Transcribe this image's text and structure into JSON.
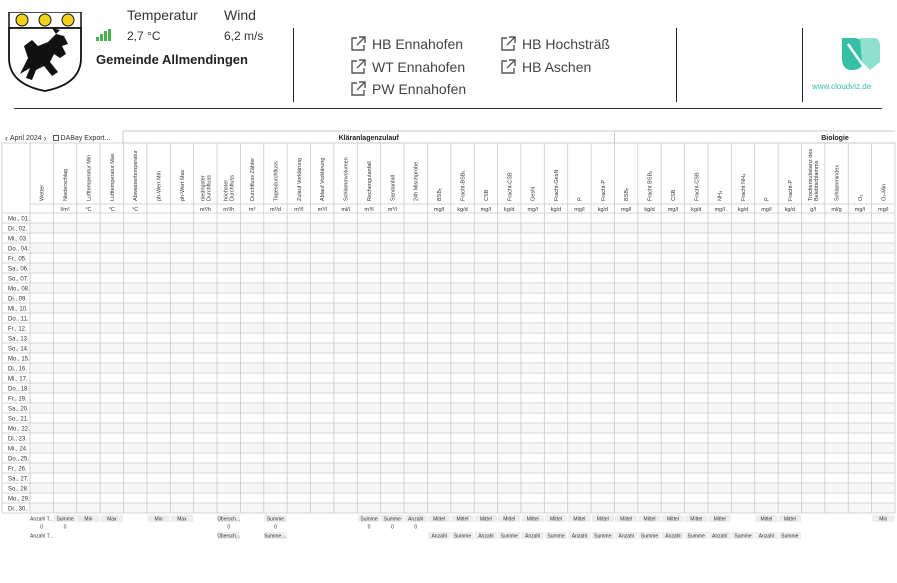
{
  "weather": {
    "temp_label": "Temperatur",
    "temp_value": "2,7 °C",
    "wind_label": "Wind",
    "wind_value": "6,2 m/s"
  },
  "municipality": "Gemeinde Allmendingen",
  "links": [
    {
      "label": "HB Ennahofen"
    },
    {
      "label": "WT Ennahofen"
    },
    {
      "label": "PW Ennahofen"
    },
    {
      "label": "HB Hochsträß"
    },
    {
      "label": "HB Aschen"
    }
  ],
  "brand": {
    "url": "www.cloudviz.de",
    "color": "#35bfa7"
  },
  "toolbar": {
    "month": "April 2024",
    "export_label": "DABay Export..."
  },
  "table": {
    "group_headers": [
      {
        "label": "Kläranlagenzulauf"
      },
      {
        "label": "Biologie"
      }
    ],
    "columns": [
      {
        "label": "Wetter",
        "unit": ""
      },
      {
        "label": "Niederschlag",
        "unit": "l/m²"
      },
      {
        "label": "Lufttemperatur Min",
        "unit": "°C"
      },
      {
        "label": "Lufttemperatur Max",
        "unit": "°C"
      },
      {
        "label": "Abwassertemperatur",
        "unit": "°C"
      },
      {
        "label": "ph-Wert Min",
        "unit": ""
      },
      {
        "label": "ph-Wert Max",
        "unit": ""
      },
      {
        "label": "niedrigster Durchfluss",
        "unit": "m³/h"
      },
      {
        "label": "höchster Durchfluss",
        "unit": "m³/h"
      },
      {
        "label": "Durchfluss Zähler",
        "unit": "m³"
      },
      {
        "label": "Tagesdurchfluss",
        "unit": "m³/d"
      },
      {
        "label": "Zulauf Vorklärung",
        "unit": "m³/l"
      },
      {
        "label": "Ablauf Vorklärung",
        "unit": "m³/l"
      },
      {
        "label": "Schlammvolumen",
        "unit": "ml/l"
      },
      {
        "label": "Rechengutanfall",
        "unit": "m³/l"
      },
      {
        "label": "Sandanfall",
        "unit": "m³/l"
      },
      {
        "label": "24h Mischprobe",
        "unit": ""
      },
      {
        "label": "BSB₅",
        "unit": "mg/l"
      },
      {
        "label": "Fracht-BSB₅",
        "unit": "kg/d"
      },
      {
        "label": "CSB",
        "unit": "mg/l"
      },
      {
        "label": "Fracht-CSB",
        "unit": "kg/d"
      },
      {
        "label": "GesN",
        "unit": "mg/l"
      },
      {
        "label": "Fracht-GesN",
        "unit": "kg/d"
      },
      {
        "label": "P",
        "unit": "mg/l"
      },
      {
        "label": "Fracht-P",
        "unit": "kg/d"
      },
      {
        "label": "BSB₅",
        "unit": "mg/l"
      },
      {
        "label": "Fracht BSB₅",
        "unit": "kg/d"
      },
      {
        "label": "CSB",
        "unit": "mg/l"
      },
      {
        "label": "Fracht-CSB",
        "unit": "kg/d"
      },
      {
        "label": "NH₄",
        "unit": "mg/l"
      },
      {
        "label": "Fracht NH₄",
        "unit": "kg/d"
      },
      {
        "label": "P",
        "unit": "mg/l"
      },
      {
        "label": "Fracht-P",
        "unit": "kg/d"
      },
      {
        "label": "Trockensubstanz des Belebtschlamms",
        "unit": "g/l"
      },
      {
        "label": "Schlammindex",
        "unit": "ml/g"
      },
      {
        "label": "O₂",
        "unit": "mg/l"
      },
      {
        "label": "O₂-Min",
        "unit": "mg/l"
      }
    ],
    "rows": [
      "Mo., 01.",
      "Di., 02.",
      "Mi., 03.",
      "Do., 04.",
      "Fr., 05.",
      "Sa., 06.",
      "So., 07.",
      "Mo., 08.",
      "Di., 09.",
      "Mi., 10.",
      "Do., 11.",
      "Fr., 12.",
      "Sa., 13.",
      "So., 14.",
      "Mo., 15.",
      "Di., 16.",
      "Mi., 17.",
      "Do., 18.",
      "Fr., 19.",
      "Sa., 20.",
      "So., 21.",
      "Mo., 22.",
      "Di., 23.",
      "Mi., 24.",
      "Do., 25.",
      "Fr., 26.",
      "Sa., 27.",
      "So., 28.",
      "Mo., 29.",
      "Di., 30."
    ],
    "footer1_first": "Anzahl T...",
    "footer1": [
      "",
      "Summe",
      "Min",
      "Max",
      "",
      "Min",
      "Max",
      "",
      "Übersch...",
      "",
      "Summe",
      "",
      "",
      "",
      "Summe",
      "Summe",
      "Anzahl",
      "Mittel",
      "Mittel",
      "Mittel",
      "Mittel",
      "Mittel",
      "Mittel",
      "Mittel",
      "Mittel",
      "Mittel",
      "Mittel",
      "Mittel",
      "Mittel",
      "Mittel",
      "",
      "Mittel",
      "Mittel",
      "",
      "",
      "",
      "Min"
    ],
    "footer2": [
      "0",
      "0",
      "",
      "",
      "",
      "",
      "",
      "",
      "0",
      "",
      "0",
      "",
      "",
      "",
      "0",
      "0",
      "0",
      "",
      "",
      "",
      "",
      "",
      "",
      "",
      "",
      "",
      "",
      "",
      "",
      "",
      "",
      "",
      "",
      "",
      "",
      "",
      ""
    ],
    "footer3_first": "Anzahl T...",
    "footer3": [
      "",
      "",
      "",
      "",
      "",
      "",
      "",
      "",
      "Übersch...",
      "",
      "Summe ...",
      "",
      "",
      "",
      "",
      "",
      "",
      "Anzahl",
      "Summe",
      "Anzahl",
      "Summe",
      "Anzahl",
      "Summe",
      "Anzahl",
      "Summe",
      "Anzahl",
      "Summe",
      "Anzahl",
      "Summe",
      "Anzahl",
      "Summe",
      "Anzahl",
      "Summe",
      "",
      "",
      "",
      ""
    ]
  }
}
